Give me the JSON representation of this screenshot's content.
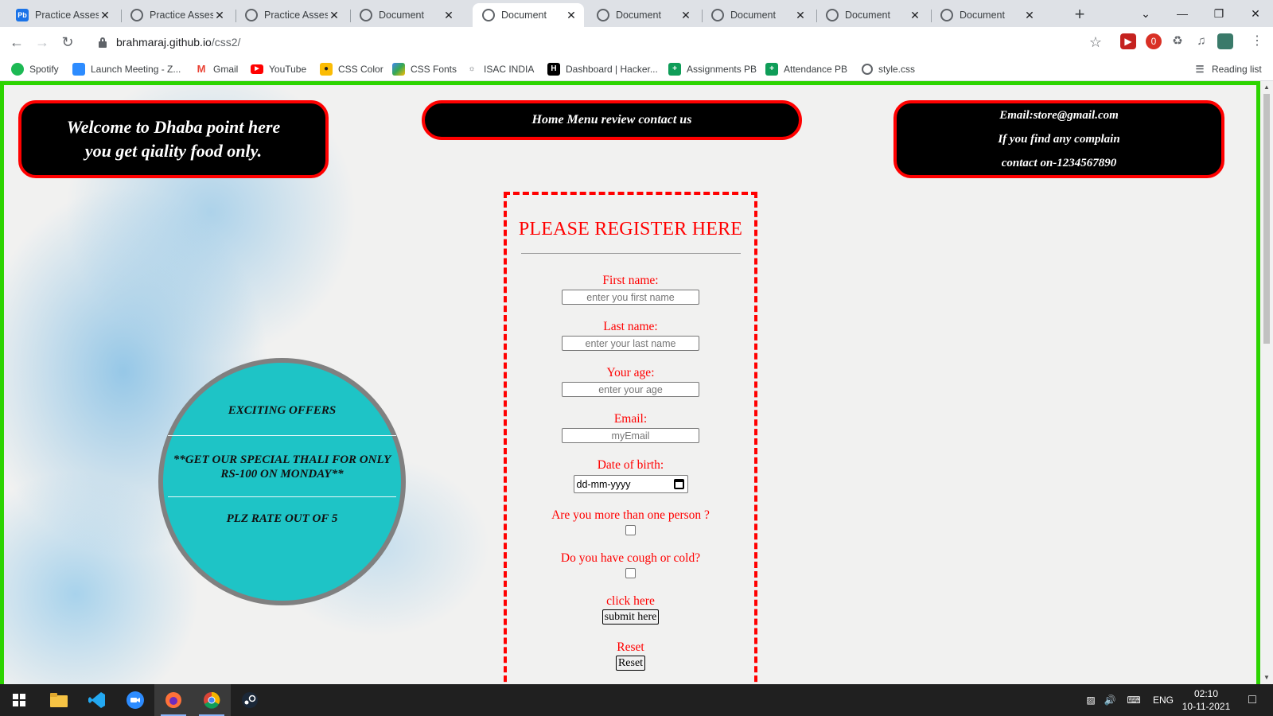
{
  "browser": {
    "tabs": [
      {
        "title": "Practice Assess",
        "icon": "pb-icon",
        "active": false
      },
      {
        "title": "Practice Assess",
        "icon": "globe-icon",
        "active": false
      },
      {
        "title": "Practice Assess",
        "icon": "globe-icon",
        "active": false
      },
      {
        "title": "Document",
        "icon": "globe-icon",
        "active": false
      },
      {
        "title": "Document",
        "icon": "globe-icon",
        "active": true
      },
      {
        "title": "Document",
        "icon": "globe-icon",
        "active": false
      },
      {
        "title": "Document",
        "icon": "globe-icon",
        "active": false
      },
      {
        "title": "Document",
        "icon": "globe-icon",
        "active": false
      },
      {
        "title": "Document",
        "icon": "globe-icon",
        "active": false
      }
    ],
    "tab_close_glyph": "✕",
    "new_tab_glyph": "+",
    "url_host": "brahmaraj.github.io",
    "url_path": "/css2/",
    "bookmarks": [
      {
        "label": "Spotify",
        "icon": "spotify-icon",
        "color": "#1db954"
      },
      {
        "label": "Launch Meeting - Z...",
        "icon": "zoom-icon",
        "color": "#2d8cff"
      },
      {
        "label": "Gmail",
        "icon": "gmail-icon",
        "color": "#ea4335"
      },
      {
        "label": "YouTube",
        "icon": "youtube-icon",
        "color": "#ff0000"
      },
      {
        "label": "CSS Color",
        "icon": "css-color-icon",
        "color": "#222222"
      },
      {
        "label": "CSS Fonts",
        "icon": "css-fonts-icon",
        "color": "#34a853"
      },
      {
        "label": "ISAC INDIA",
        "icon": "isac-icon",
        "color": "#5f6368"
      },
      {
        "label": "Dashboard | Hacker...",
        "icon": "hackerrank-icon",
        "color": "#000000"
      },
      {
        "label": "Assignments PB",
        "icon": "sheets-icon",
        "color": "#0f9d58"
      },
      {
        "label": "Attendance PB",
        "icon": "sheets-icon",
        "color": "#0f9d58"
      },
      {
        "label": "style.css",
        "icon": "globe-icon",
        "color": "#5f6368"
      }
    ],
    "reading_list": "Reading list",
    "extension_badge": "0"
  },
  "page": {
    "welcome_line1": "Welcome to Dhaba point here",
    "welcome_line2": "you get qiality food only.",
    "nav_text": "Home Menu review contact us",
    "contact_line1": "Email:store@gmail.com",
    "contact_line2": "If you find any complain",
    "contact_line3": "contact on-1234567890",
    "offers": {
      "title": "EXCITING OFFERS",
      "special": "**GET OUR SPECIAL THALI FOR ONLY RS-100 ON MONDAY**",
      "rate": "PLZ RATE OUT OF 5"
    },
    "form": {
      "heading": "PLEASE REGISTER HERE",
      "first_name_label": "First name:",
      "first_name_placeholder": "enter you first name",
      "last_name_label": "Last name:",
      "last_name_placeholder": "enter your last name",
      "age_label": "Your age:",
      "age_placeholder": "enter your age",
      "email_label": "Email:",
      "email_placeholder": "myEmail",
      "dob_label": "Date of birth:",
      "dob_value": "dd-mm-yyyy",
      "person_label": "Are you more than one person ?",
      "cough_label": "Do you have cough or cold?",
      "click_label": "click here",
      "submit_button": "submit here",
      "reset_label": "Reset",
      "reset_button": "Reset"
    },
    "colors": {
      "border_green": "#2cd400",
      "accent_red": "#ff0000",
      "circle_teal": "#1ec4c6"
    }
  },
  "taskbar": {
    "apps": [
      "start-icon",
      "file-explorer-icon",
      "vscode-icon",
      "zoom-icon",
      "firefox-icon",
      "chrome-icon",
      "steam-icon"
    ],
    "language": "ENG",
    "time": "02:10",
    "date": "10-11-2021"
  }
}
